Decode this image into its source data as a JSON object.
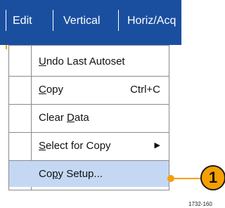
{
  "menubar": {
    "items": [
      "Edit",
      "Vertical",
      "Horiz/Acq"
    ]
  },
  "menu": {
    "items": [
      {
        "pre": "",
        "u": "U",
        "post": "ndo Last Autoset",
        "shortcut": ""
      },
      {
        "pre": "",
        "u": "C",
        "post": "opy",
        "shortcut": "Ctrl+C"
      },
      {
        "pre": "Clear ",
        "u": "D",
        "post": "ata",
        "shortcut": ""
      },
      {
        "pre": "",
        "u": "S",
        "post": "elect for Copy",
        "shortcut": "",
        "submenu": true
      },
      {
        "pre": "Co",
        "u": "p",
        "post": "y Setup...",
        "shortcut": "",
        "highlighted": true
      }
    ]
  },
  "callout": {
    "number": "1"
  },
  "figure_id": "1732-160",
  "colors": {
    "menubar": "#1a4fa0",
    "highlight": "#c4d8f3",
    "callout": "#f5a000"
  }
}
